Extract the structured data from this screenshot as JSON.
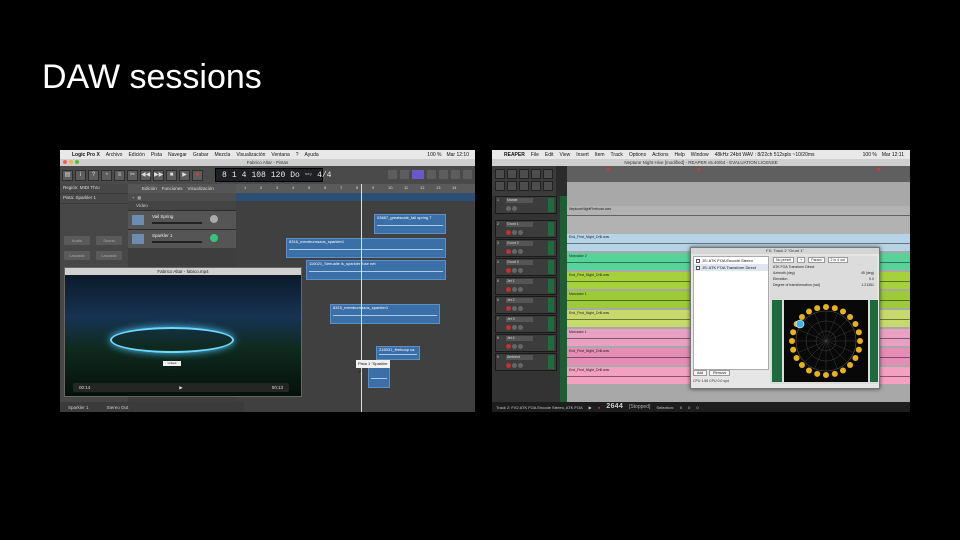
{
  "slide": {
    "title": "DAW sessions"
  },
  "logic": {
    "menubar": {
      "apple": "",
      "items": [
        "Logic Pro X",
        "Archivo",
        "Edición",
        "Pista",
        "Navegar",
        "Grabar",
        "Mezcla",
        "Visualización",
        "Ventana",
        "?",
        "Ayuda"
      ],
      "right": [
        "100 %",
        "Mar 12:10"
      ]
    },
    "window_title": "Fabrico Altar - Pistas",
    "lcd": {
      "bar": "8",
      "beat": "1",
      "sub": "4",
      "tempo": "108",
      "sig": "120",
      "key": "Do",
      "mode": "may",
      "div": "4/4",
      "bar_label": "COMPÁS",
      "tempo_label": "TEMPO"
    },
    "inspector": {
      "rows": [
        "Región: MIDI Thru",
        "Pista: Sparkler 1"
      ],
      "buttons": [
        "Audio",
        "Sound",
        "Lanzado",
        "Lanzado",
        "Lanzado",
        "Lanzado"
      ]
    },
    "trackheader_toolbar": [
      "Edición",
      "Funciones",
      "Visualización"
    ],
    "video_track_label": "Vídeo",
    "tracks": [
      {
        "name": "Vail Spring"
      },
      {
        "name": "Sparkler 1"
      }
    ],
    "ruler": [
      "1",
      "2",
      "3",
      "4",
      "5",
      "6",
      "7",
      "8",
      "9",
      "10",
      "11",
      "12",
      "13",
      "14"
    ],
    "regions": [
      {
        "label": "03687_greatscale_fail spring 7"
      },
      {
        "label": "8316_memburnazos_sparkler1"
      },
      {
        "label": "110021_Seeualle ls_sparkler fuse net"
      },
      {
        "label": "8315_memburnazos_sparkler1"
      },
      {
        "label": "216031_firehoop ca"
      },
      {
        "label": ""
      }
    ],
    "video_window": {
      "title": "Fabrico Altar - fabico.mp4",
      "time_start": "00:14",
      "time_end": "00:13",
      "bubble": "Untied Theme"
    },
    "tooltip": "Pista 1 \"Sparkler 1\"",
    "bottom_labels": [
      "Sparkler 1",
      "Stereo Out"
    ],
    "traffic_colors": [
      "#fc5b57",
      "#e5bf3c",
      "#57c038"
    ]
  },
  "reaper": {
    "menubar": {
      "items": [
        "REAPER",
        "File",
        "Edit",
        "View",
        "Insert",
        "Item",
        "Track",
        "Options",
        "Actions",
        "Help",
        "Window"
      ],
      "extra": "48kHz 24bit WAV : 8/22ch 512spls ~10/20ms",
      "right": [
        "100 %",
        "Mar 12:11"
      ]
    },
    "window_title": "Neptune Night Hive [modified] - REAPER v5.40/64 - EVALUATION LICENSE",
    "tracks": [
      {
        "num": "1",
        "name": "Master"
      },
      {
        "num": "2",
        "name": "Grunt 1"
      },
      {
        "num": "3",
        "name": "Grunt 2"
      },
      {
        "num": "4",
        "name": "Grunt 3"
      },
      {
        "num": "5",
        "name": "Jet 1"
      },
      {
        "num": "6",
        "name": "Jet 2"
      },
      {
        "num": "7",
        "name": "Jet 3"
      },
      {
        "num": "8",
        "name": "Jet 4"
      },
      {
        "num": "9",
        "name": "Ambient"
      }
    ],
    "items": [
      {
        "label": "NeptuneNightFirehose.wav",
        "color": "#b2b2b2"
      },
      {
        "label": "End_First_Night_Drill.wav",
        "color": "#b7d3e6"
      },
      {
        "label": "Marcador 2",
        "color": "#57d39a"
      },
      {
        "label": "End_First_Night_Drill.wav",
        "color": "#a6d13a"
      },
      {
        "label": "Marcador 1",
        "color": "#9ccb37"
      },
      {
        "label": "End_First_Night_Drill.wav",
        "color": "#c7d96b"
      },
      {
        "label": "Marcador 1",
        "color": "#e8a0c3"
      },
      {
        "label": "End_First_Night_Drill.wav",
        "color": "#e58cb7"
      },
      {
        "label": "End_First_Night_Drill.wav",
        "color": "#f4a0c0"
      }
    ],
    "fx_window": {
      "title": "FX: Track 2 \"Grunt 1\"",
      "fx_list": [
        "JS: ATK FOA Encode Stereo",
        "JS: ATK FOA Transform Direct"
      ],
      "buttons": [
        "Add",
        "Remove"
      ],
      "cpu": "CPU 1.56 CPU 0.0 spd",
      "preset": "No preset",
      "preset_buttons": [
        "+",
        "Param",
        "2 in 4 out"
      ],
      "plugin_title": "ATK FOA Transform Direct",
      "params": [
        {
          "label": "Azimuth (deg)",
          "value": "45 (deg)"
        },
        {
          "label": "Elevation",
          "value": "0.0"
        },
        {
          "label": "Degree of transformation (rad)",
          "value": "1.21351"
        }
      ]
    },
    "transport": {
      "track_label": "Track 2: FX2 ATK FOA Encode Stereo, ATK FOA",
      "time": "2644",
      "state": "[Stopped]",
      "selection_label": "Selection:",
      "sel_values": [
        "0",
        "0",
        "0"
      ]
    },
    "traffic_colors": [
      "#fc5b57",
      "#e5bf3c",
      "#57c038"
    ]
  }
}
